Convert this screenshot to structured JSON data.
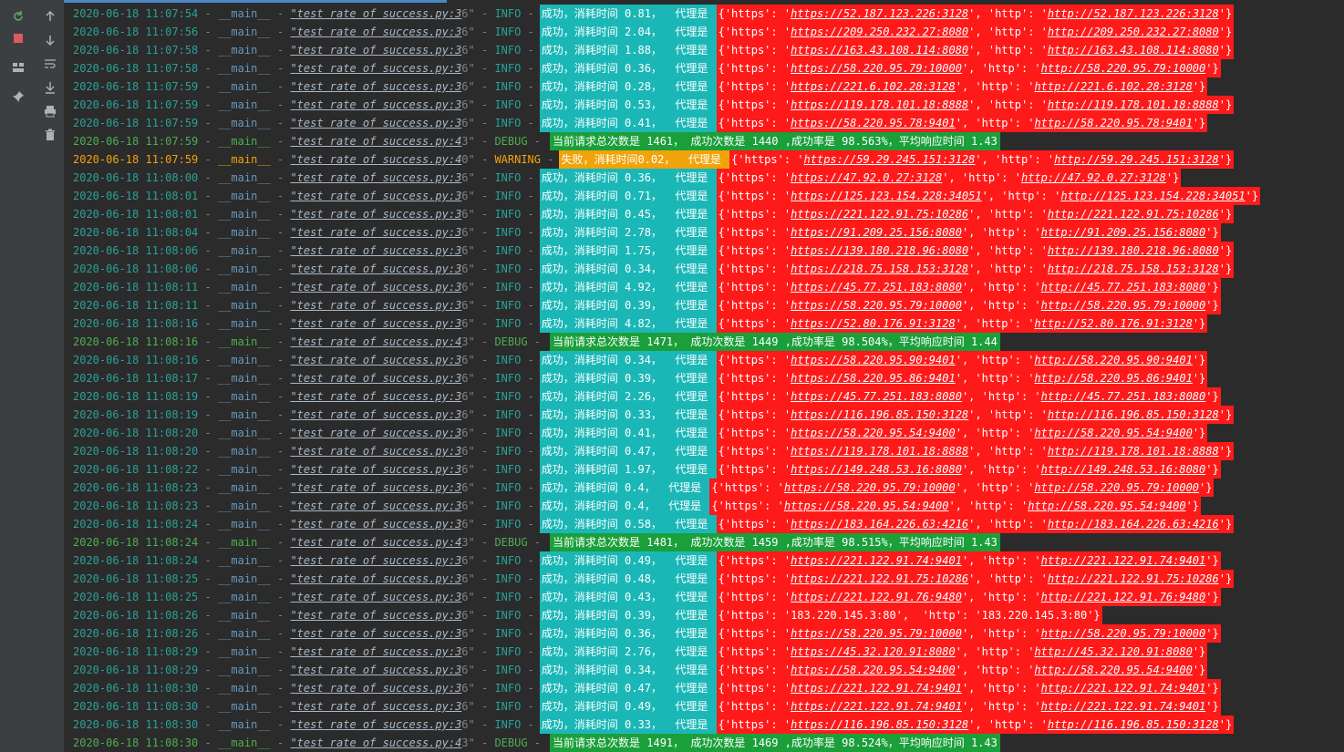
{
  "toolbar": {
    "left": [
      "rerun-icon",
      "stop-icon",
      "layout-icon",
      "pin-icon"
    ],
    "right": [
      "up-icon",
      "down-icon",
      "wrap-icon",
      "scroll-end-icon",
      "print-icon",
      "trash-icon"
    ]
  },
  "log": [
    {
      "t": "info",
      "date": "2020-06-18 11:07:54",
      "mod": "__main__",
      "file": "\"test rate of success.py:3",
      "suffix": "6\"",
      "lvl": "INFO",
      "msg": "成功，消耗时间 0.81，  代理是 ",
      "proxy": "{'https': 'https://52.187.123.226:3128', 'http': 'http://52.187.123.226:3128'}"
    },
    {
      "t": "info",
      "date": "2020-06-18 11:07:56",
      "mod": "__main__",
      "file": "\"test rate of success.py:3",
      "suffix": "6\"",
      "lvl": "INFO",
      "msg": "成功，消耗时间 2.04，  代理是 ",
      "proxy": "{'https': 'https://209.250.232.27:8080', 'http': 'http://209.250.232.27:8080'}"
    },
    {
      "t": "info",
      "date": "2020-06-18 11:07:58",
      "mod": "__main__",
      "file": "\"test rate of success.py:3",
      "suffix": "6\"",
      "lvl": "INFO",
      "msg": "成功，消耗时间 1.88，  代理是 ",
      "proxy": "{'https': 'https://163.43.108.114:8080', 'http': 'http://163.43.108.114:8080'}"
    },
    {
      "t": "info",
      "date": "2020-06-18 11:07:58",
      "mod": "__main__",
      "file": "\"test rate of success.py:3",
      "suffix": "6\"",
      "lvl": "INFO",
      "msg": "成功，消耗时间 0.36，  代理是 ",
      "proxy": "{'https': 'https://58.220.95.79:10000', 'http': 'http://58.220.95.79:10000'}"
    },
    {
      "t": "info",
      "date": "2020-06-18 11:07:59",
      "mod": "__main__",
      "file": "\"test rate of success.py:3",
      "suffix": "6\"",
      "lvl": "INFO",
      "msg": "成功，消耗时间 0.28，  代理是 ",
      "proxy": "{'https': 'https://221.6.102.28:3128', 'http': 'http://221.6.102.28:3128'}"
    },
    {
      "t": "info",
      "date": "2020-06-18 11:07:59",
      "mod": "__main__",
      "file": "\"test rate of success.py:3",
      "suffix": "6\"",
      "lvl": "INFO",
      "msg": "成功，消耗时间 0.53，  代理是 ",
      "proxy": "{'https': 'https://119.178.101.18:8888', 'http': 'http://119.178.101.18:8888'}"
    },
    {
      "t": "info",
      "date": "2020-06-18 11:07:59",
      "mod": "__main__",
      "file": "\"test rate of success.py:3",
      "suffix": "6\"",
      "lvl": "INFO",
      "msg": "成功，消耗时间 0.41，  代理是 ",
      "proxy": "{'https': 'https://58.220.95.78:9401', 'http': 'http://58.220.95.78:9401'}"
    },
    {
      "t": "debug",
      "date": "2020-06-18 11:07:59",
      "mod": "__main__",
      "file": "\"test rate of success.py:4",
      "suffix": "3\"",
      "lvl": "DEBUG",
      "msg": "当前请求总次数是 1461， 成功次数是 1440 ,成功率是 98.563%，平均响应时间 1.43"
    },
    {
      "t": "warning",
      "date": "2020-06-18 11:07:59",
      "mod": "__main__",
      "file": "\"test rate of success.py:4",
      "suffix": "0\"",
      "lvl": "WARNING",
      "msg": "失败，消耗时间0.02，  代理是 ",
      "proxy": "{'https': 'https://59.29.245.151:3128', 'http': 'http://59.29.245.151:3128'}"
    },
    {
      "t": "info",
      "date": "2020-06-18 11:08:00",
      "mod": "__main__",
      "file": "\"test rate of success.py:3",
      "suffix": "6\"",
      "lvl": "INFO",
      "msg": "成功，消耗时间 0.36，  代理是 ",
      "proxy": "{'https': 'https://47.92.0.27:3128', 'http': 'http://47.92.0.27:3128'}"
    },
    {
      "t": "info",
      "date": "2020-06-18 11:08:01",
      "mod": "__main__",
      "file": "\"test rate of success.py:3",
      "suffix": "6\"",
      "lvl": "INFO",
      "msg": "成功，消耗时间 0.71，  代理是 ",
      "proxy": "{'https': 'https://125.123.154.228:34051', 'http': 'http://125.123.154.228:34051'}"
    },
    {
      "t": "info",
      "date": "2020-06-18 11:08:01",
      "mod": "__main__",
      "file": "\"test rate of success.py:3",
      "suffix": "6\"",
      "lvl": "INFO",
      "msg": "成功，消耗时间 0.45，  代理是 ",
      "proxy": "{'https': 'https://221.122.91.75:10286', 'http': 'http://221.122.91.75:10286'}"
    },
    {
      "t": "info",
      "date": "2020-06-18 11:08:04",
      "mod": "__main__",
      "file": "\"test rate of success.py:3",
      "suffix": "6\"",
      "lvl": "INFO",
      "msg": "成功，消耗时间 2.78，  代理是 ",
      "proxy": "{'https': 'https://91.209.25.156:8080', 'http': 'http://91.209.25.156:8080'}"
    },
    {
      "t": "info",
      "date": "2020-06-18 11:08:06",
      "mod": "__main__",
      "file": "\"test rate of success.py:3",
      "suffix": "6\"",
      "lvl": "INFO",
      "msg": "成功，消耗时间 1.75，  代理是 ",
      "proxy": "{'https': 'https://139.180.218.96:8080', 'http': 'http://139.180.218.96:8080'}"
    },
    {
      "t": "info",
      "date": "2020-06-18 11:08:06",
      "mod": "__main__",
      "file": "\"test rate of success.py:3",
      "suffix": "6\"",
      "lvl": "INFO",
      "msg": "成功，消耗时间 0.34，  代理是 ",
      "proxy": "{'https': 'https://218.75.158.153:3128', 'http': 'http://218.75.158.153:3128'}"
    },
    {
      "t": "info",
      "date": "2020-06-18 11:08:11",
      "mod": "__main__",
      "file": "\"test rate of success.py:3",
      "suffix": "6\"",
      "lvl": "INFO",
      "msg": "成功，消耗时间 4.92，  代理是 ",
      "proxy": "{'https': 'https://45.77.251.183:8080', 'http': 'http://45.77.251.183:8080'}"
    },
    {
      "t": "info",
      "date": "2020-06-18 11:08:11",
      "mod": "__main__",
      "file": "\"test rate of success.py:3",
      "suffix": "6\"",
      "lvl": "INFO",
      "msg": "成功，消耗时间 0.39，  代理是 ",
      "proxy": "{'https': 'https://58.220.95.79:10000', 'http': 'http://58.220.95.79:10000'}"
    },
    {
      "t": "info",
      "date": "2020-06-18 11:08:16",
      "mod": "__main__",
      "file": "\"test rate of success.py:3",
      "suffix": "6\"",
      "lvl": "INFO",
      "msg": "成功，消耗时间 4.82，  代理是 ",
      "proxy": "{'https': 'https://52.80.176.91:3128', 'http': 'http://52.80.176.91:3128'}"
    },
    {
      "t": "debug",
      "date": "2020-06-18 11:08:16",
      "mod": "__main__",
      "file": "\"test rate of success.py:4",
      "suffix": "3\"",
      "lvl": "DEBUG",
      "msg": "当前请求总次数是 1471， 成功次数是 1449 ,成功率是 98.504%，平均响应时间 1.44"
    },
    {
      "t": "info",
      "date": "2020-06-18 11:08:16",
      "mod": "__main__",
      "file": "\"test rate of success.py:3",
      "suffix": "6\"",
      "lvl": "INFO",
      "msg": "成功，消耗时间 0.34，  代理是 ",
      "proxy": "{'https': 'https://58.220.95.90:9401', 'http': 'http://58.220.95.90:9401'}"
    },
    {
      "t": "info",
      "date": "2020-06-18 11:08:17",
      "mod": "__main__",
      "file": "\"test rate of success.py:3",
      "suffix": "6\"",
      "lvl": "INFO",
      "msg": "成功，消耗时间 0.39，  代理是 ",
      "proxy": "{'https': 'https://58.220.95.86:9401', 'http': 'http://58.220.95.86:9401'}"
    },
    {
      "t": "info",
      "date": "2020-06-18 11:08:19",
      "mod": "__main__",
      "file": "\"test rate of success.py:3",
      "suffix": "6\"",
      "lvl": "INFO",
      "msg": "成功，消耗时间 2.26，  代理是 ",
      "proxy": "{'https': 'https://45.77.251.183:8080', 'http': 'http://45.77.251.183:8080'}"
    },
    {
      "t": "info",
      "date": "2020-06-18 11:08:19",
      "mod": "__main__",
      "file": "\"test rate of success.py:3",
      "suffix": "6\"",
      "lvl": "INFO",
      "msg": "成功，消耗时间 0.33，  代理是 ",
      "proxy": "{'https': 'https://116.196.85.150:3128', 'http': 'http://116.196.85.150:3128'}"
    },
    {
      "t": "info",
      "date": "2020-06-18 11:08:20",
      "mod": "__main__",
      "file": "\"test rate of success.py:3",
      "suffix": "6\"",
      "lvl": "INFO",
      "msg": "成功，消耗时间 0.41，  代理是 ",
      "proxy": "{'https': 'https://58.220.95.54:9400', 'http': 'http://58.220.95.54:9400'}"
    },
    {
      "t": "info",
      "date": "2020-06-18 11:08:20",
      "mod": "__main__",
      "file": "\"test rate of success.py:3",
      "suffix": "6\"",
      "lvl": "INFO",
      "msg": "成功，消耗时间 0.47，  代理是 ",
      "proxy": "{'https': 'https://119.178.101.18:8888', 'http': 'http://119.178.101.18:8888'}"
    },
    {
      "t": "info",
      "date": "2020-06-18 11:08:22",
      "mod": "__main__",
      "file": "\"test rate of success.py:3",
      "suffix": "6\"",
      "lvl": "INFO",
      "msg": "成功，消耗时间 1.97，  代理是 ",
      "proxy": "{'https': 'https://149.248.53.16:8080', 'http': 'http://149.248.53.16:8080'}"
    },
    {
      "t": "info",
      "date": "2020-06-18 11:08:23",
      "mod": "__main__",
      "file": "\"test rate of success.py:3",
      "suffix": "6\"",
      "lvl": "INFO",
      "msg": "成功，消耗时间 0.4，  代理是 ",
      "proxy": "{'https': 'https://58.220.95.79:10000', 'http': 'http://58.220.95.79:10000'}"
    },
    {
      "t": "info",
      "date": "2020-06-18 11:08:23",
      "mod": "__main__",
      "file": "\"test rate of success.py:3",
      "suffix": "6\"",
      "lvl": "INFO",
      "msg": "成功，消耗时间 0.4，  代理是 ",
      "proxy": "{'https': 'https://58.220.95.54:9400', 'http': 'http://58.220.95.54:9400'}"
    },
    {
      "t": "info",
      "date": "2020-06-18 11:08:24",
      "mod": "__main__",
      "file": "\"test rate of success.py:3",
      "suffix": "6\"",
      "lvl": "INFO",
      "msg": "成功，消耗时间 0.58，  代理是 ",
      "proxy": "{'https': 'https://183.164.226.63:4216', 'http': 'http://183.164.226.63:4216'}"
    },
    {
      "t": "debug",
      "date": "2020-06-18 11:08:24",
      "mod": "__main__",
      "file": "\"test rate of success.py:4",
      "suffix": "3\"",
      "lvl": "DEBUG",
      "msg": "当前请求总次数是 1481， 成功次数是 1459 ,成功率是 98.515%，平均响应时间 1.43"
    },
    {
      "t": "info",
      "date": "2020-06-18 11:08:24",
      "mod": "__main__",
      "file": "\"test rate of success.py:3",
      "suffix": "6\"",
      "lvl": "INFO",
      "msg": "成功，消耗时间 0.49，  代理是 ",
      "proxy": "{'https': 'https://221.122.91.74:9401', 'http': 'http://221.122.91.74:9401'}"
    },
    {
      "t": "info",
      "date": "2020-06-18 11:08:25",
      "mod": "__main__",
      "file": "\"test rate of success.py:3",
      "suffix": "6\"",
      "lvl": "INFO",
      "msg": "成功，消耗时间 0.48，  代理是 ",
      "proxy": "{'https': 'https://221.122.91.75:10286', 'http': 'http://221.122.91.75:10286'}"
    },
    {
      "t": "info",
      "date": "2020-06-18 11:08:25",
      "mod": "__main__",
      "file": "\"test rate of success.py:3",
      "suffix": "6\"",
      "lvl": "INFO",
      "msg": "成功，消耗时间 0.43，  代理是 ",
      "proxy": "{'https': 'https://221.122.91.76:9480', 'http': 'http://221.122.91.76:9480'}"
    },
    {
      "t": "info",
      "date": "2020-06-18 11:08:26",
      "mod": "__main__",
      "file": "\"test rate of success.py:3",
      "suffix": "6\"",
      "lvl": "INFO",
      "msg": "成功，消耗时间 0.39，  代理是 ",
      "proxy": "{'https': '183.220.145.3:80',  'http': '183.220.145.3:80'}"
    },
    {
      "t": "info",
      "date": "2020-06-18 11:08:26",
      "mod": "__main__",
      "file": "\"test rate of success.py:3",
      "suffix": "6\"",
      "lvl": "INFO",
      "msg": "成功，消耗时间 0.36，  代理是 ",
      "proxy": "{'https': 'https://58.220.95.79:10000', 'http': 'http://58.220.95.79:10000'}"
    },
    {
      "t": "info",
      "date": "2020-06-18 11:08:29",
      "mod": "__main__",
      "file": "\"test rate of success.py:3",
      "suffix": "6\"",
      "lvl": "INFO",
      "msg": "成功，消耗时间 2.76，  代理是 ",
      "proxy": "{'https': 'https://45.32.120.91:8080', 'http': 'http://45.32.120.91:8080'}"
    },
    {
      "t": "info",
      "date": "2020-06-18 11:08:29",
      "mod": "__main__",
      "file": "\"test rate of success.py:3",
      "suffix": "6\"",
      "lvl": "INFO",
      "msg": "成功，消耗时间 0.34，  代理是 ",
      "proxy": "{'https': 'https://58.220.95.54:9400', 'http': 'http://58.220.95.54:9400'}"
    },
    {
      "t": "info",
      "date": "2020-06-18 11:08:30",
      "mod": "__main__",
      "file": "\"test rate of success.py:3",
      "suffix": "6\"",
      "lvl": "INFO",
      "msg": "成功，消耗时间 0.47，  代理是 ",
      "proxy": "{'https': 'https://221.122.91.74:9401', 'http': 'http://221.122.91.74:9401'}"
    },
    {
      "t": "info",
      "date": "2020-06-18 11:08:30",
      "mod": "__main__",
      "file": "\"test rate of success.py:3",
      "suffix": "6\"",
      "lvl": "INFO",
      "msg": "成功，消耗时间 0.49，  代理是 ",
      "proxy": "{'https': 'https://221.122.91.74:9401', 'http': 'http://221.122.91.74:9401'}"
    },
    {
      "t": "info",
      "date": "2020-06-18 11:08:30",
      "mod": "__main__",
      "file": "\"test rate of success.py:3",
      "suffix": "6\"",
      "lvl": "INFO",
      "msg": "成功，消耗时间 0.33，  代理是 ",
      "proxy": "{'https': 'https://116.196.85.150:3128', 'http': 'http://116.196.85.150:3128'}"
    },
    {
      "t": "debug",
      "date": "2020-06-18 11:08:30",
      "mod": "__main__",
      "file": "\"test rate of success.py:4",
      "suffix": "3\"",
      "lvl": "DEBUG",
      "msg": "当前请求总次数是 1491， 成功次数是 1469 ,成功率是 98.524%，平均响应时间 1.43"
    }
  ]
}
